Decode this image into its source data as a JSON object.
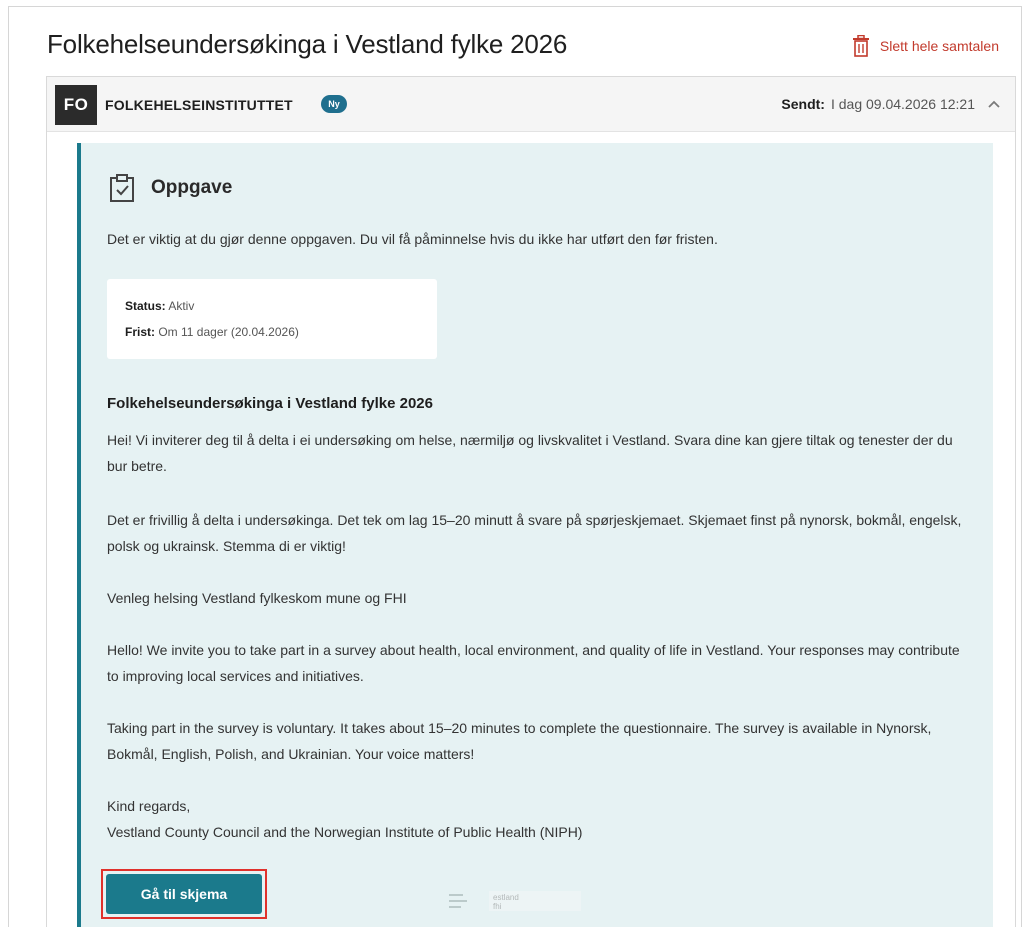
{
  "page": {
    "title": "Folkehelseundersøkinga i Vestland fylke 2026",
    "delete_all_label": "Slett hele samtalen"
  },
  "message": {
    "sender_initials": "FO",
    "sender_name": "FOLKEHELSEINSTITUTTET",
    "new_badge": "Ny",
    "sent_label": "Sendt:",
    "sent_value": "I dag 09.04.2026 12:21"
  },
  "task": {
    "heading": "Oppgave",
    "intro": "Det er viktig at du gjør denne oppgaven. Du vil få påminnelse hvis du ikke har utført den før fristen.",
    "status_label": "Status:",
    "status_value": "Aktiv",
    "deadline_label": "Frist:",
    "deadline_value": "Om 11 dager (20.04.2026)"
  },
  "body": {
    "title": "Folkehelseundersøkinga i Vestland fylke 2026",
    "paragraphs": [
      "Hei! Vi inviterer deg til å delta i ei undersøking om helse, nærmiljø og livskvalitet i Vestland. Svara dine kan gjere tiltak og tenester der du bur betre.",
      "Det er frivillig å delta i undersøkinga. Det tek om lag 15–20 minutt å svare på spørjeskjemaet. Skjemaet finst på nynorsk, bokmål, engelsk, polsk og ukrainsk. Stemma di er viktig!",
      "Venleg helsing Vestland fylkeskom mune og FHI",
      "Hello! We invite you to take part in a survey about health, local environment, and quality of life in Vestland. Your responses may contribute to improving local services and initiatives.",
      "Taking part in the survey is voluntary. It takes about 15–20 minutes to complete the questionnaire. The survey is available in Nynorsk, Bokmål, English, Polish, and Ukrainian. Your voice matters!"
    ],
    "regards": "Kind regards,",
    "signature": "Vestland County Council and the Norwegian Institute of Public Health (NIPH)"
  },
  "cta": {
    "label": "Gå til skjema"
  },
  "footer": {
    "logo_text_1": "estland",
    "logo_text_2": "fhi"
  },
  "colors": {
    "accent": "#1b7a8c",
    "task_bg": "#e6f2f3",
    "danger": "#c23a2c",
    "highlight_outline": "#e0312b",
    "badge": "#1f6f8e"
  },
  "icons": {
    "delete": "trash-icon",
    "task": "clipboard-check-icon",
    "collapse": "chevron-up-icon"
  }
}
